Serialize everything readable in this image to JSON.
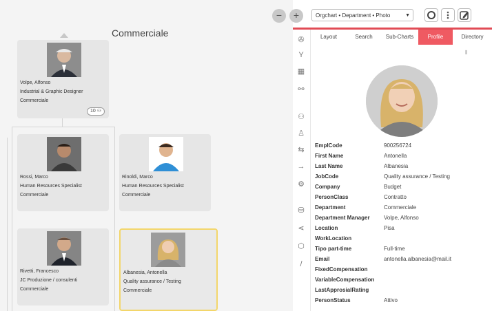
{
  "chart": {
    "title": "Commerciale",
    "cards": [
      {
        "name": "Volpe, Alfonso",
        "role": "Industrial & Graphic Designer",
        "dept": "Commerciale",
        "badge": "10 ⚇"
      },
      {
        "name": "Rossi, Marco",
        "role": "Human Resources Specialist",
        "dept": "Commerciale"
      },
      {
        "name": "Rinoldi, Marco",
        "role": "Human Resources Specialist",
        "dept": "Commerciale"
      },
      {
        "name": "Rivetti, Francesco",
        "role": "JC Produzione / consulenti",
        "dept": "Commerciale"
      },
      {
        "name": "Albanesia, Antonella",
        "role": "Quality assurance / Testing",
        "dept": "Commerciale"
      }
    ]
  },
  "toolbar": {
    "zoom_out": "−",
    "zoom_in": "+",
    "view_select": "Orgchart • Department • Photo"
  },
  "tabs": [
    "Layout",
    "Search",
    "Sub-Charts",
    "Profile",
    "Directory"
  ],
  "active_tab": "Profile",
  "profile": {
    "fields": [
      {
        "label": "EmplCode",
        "value": "900256724"
      },
      {
        "label": "First Name",
        "value": "Antonella"
      },
      {
        "label": "Last Name",
        "value": "Albanesia"
      },
      {
        "label": "JobCode",
        "value": "Quality assurance / Testing"
      },
      {
        "label": "Company",
        "value": "Budget"
      },
      {
        "label": "PersonClass",
        "value": "Contratto"
      },
      {
        "label": "Department",
        "value": "Commerciale"
      },
      {
        "label": "Department Manager",
        "value": "Volpe, Alfonso"
      },
      {
        "label": "Location",
        "value": "Pisa"
      },
      {
        "label": "WorkLocation",
        "value": ""
      },
      {
        "label": "Tipo part-time",
        "value": "Full-time"
      },
      {
        "label": "Email",
        "value": "antonella.albanesia@mail.it"
      },
      {
        "label": "FixedCompensation",
        "value": ""
      },
      {
        "label": "VariableCompensation",
        "value": ""
      },
      {
        "label": "LastApprosialRating",
        "value": ""
      },
      {
        "label": "PersonStatus",
        "value": "Attivo"
      }
    ]
  },
  "colors": {
    "accent": "#ef5a62",
    "selected_border": "#f3d66a"
  }
}
